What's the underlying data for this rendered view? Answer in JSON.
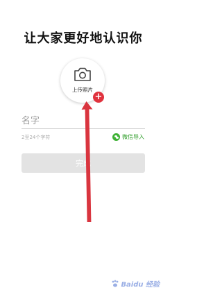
{
  "header": {
    "title": "让大家更好地认识你"
  },
  "photo": {
    "upload_label": "上传照片",
    "add_badge": "+",
    "icon": "camera-icon"
  },
  "form": {
    "name_placeholder": "名字",
    "hint": "2至24个字符",
    "wechat_import_label": "微信导入",
    "wechat_icon": "wechat-icon",
    "submit_label": "完成"
  },
  "watermark": {
    "text": "Baidu 经验"
  },
  "colors": {
    "accent_red": "#e0323d",
    "wechat_green": "#3eb135",
    "button_disabled": "#e3e3e3",
    "annotation_arrow": "#d9353f"
  }
}
